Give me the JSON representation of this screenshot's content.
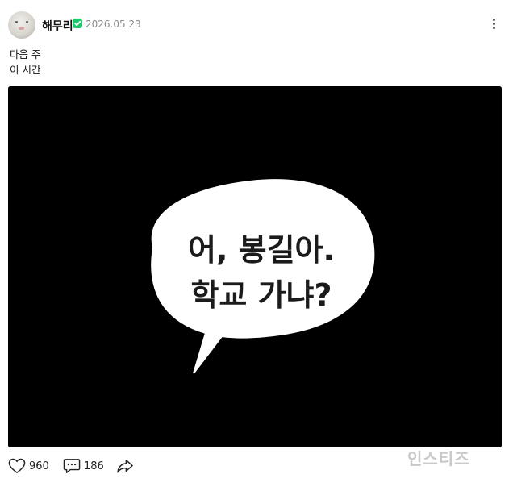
{
  "post": {
    "username": "해무리",
    "date": "2026.05.23",
    "caption_lines": [
      "다음 주",
      "이 시간"
    ],
    "image": {
      "speech_line_1": "어, 봉길아.",
      "speech_line_2": "학교 가냐?",
      "background_color": "#000000"
    },
    "watermark": "인스티즈",
    "verified_color": "#1ec96e"
  },
  "actions": {
    "like_count": "960",
    "comment_count": "186"
  },
  "icons": {
    "verified": "verified-badge-icon",
    "more": "more-vertical-icon",
    "like": "heart-icon",
    "comment": "comment-icon",
    "share": "share-arrow-icon"
  }
}
